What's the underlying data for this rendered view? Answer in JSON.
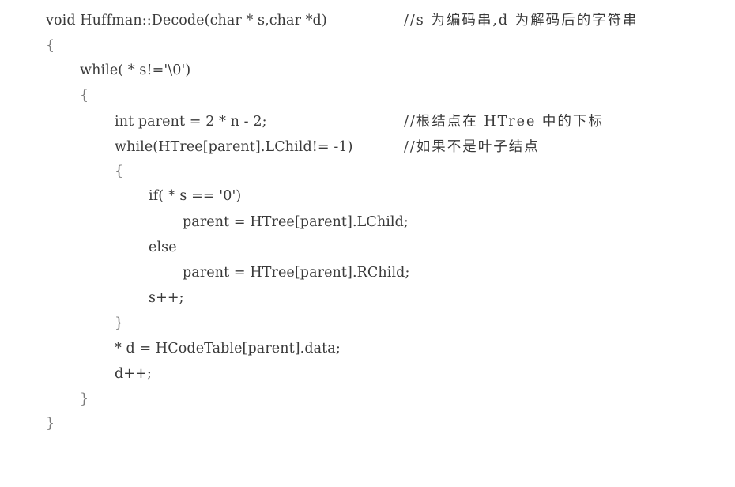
{
  "code_listing": {
    "lines": [
      {
        "code": "void Huffman::Decode(char * s,char *d)",
        "comment": "//s 为编码串,d 为解码后的字符串"
      },
      {
        "code": "{",
        "comment": ""
      },
      {
        "code": "while( * s!='\\0')",
        "comment": ""
      },
      {
        "code": "{",
        "comment": ""
      },
      {
        "code": "int parent = 2 * n - 2;",
        "comment": "//根结点在 HTree 中的下标"
      },
      {
        "code": "while(HTree[parent].LChild!= -1)",
        "comment": "//如果不是叶子结点"
      },
      {
        "code": "{",
        "comment": ""
      },
      {
        "code": "if( * s == '0')",
        "comment": ""
      },
      {
        "code": "parent = HTree[parent].LChild;",
        "comment": ""
      },
      {
        "code": "else",
        "comment": ""
      },
      {
        "code": "parent = HTree[parent].RChild;",
        "comment": ""
      },
      {
        "code": "s++;",
        "comment": ""
      },
      {
        "code": "}",
        "comment": ""
      },
      {
        "code": "* d = HCodeTable[parent].data;",
        "comment": ""
      },
      {
        "code": "d++;",
        "comment": ""
      },
      {
        "code": "}",
        "comment": ""
      },
      {
        "code": "}",
        "comment": ""
      }
    ]
  }
}
